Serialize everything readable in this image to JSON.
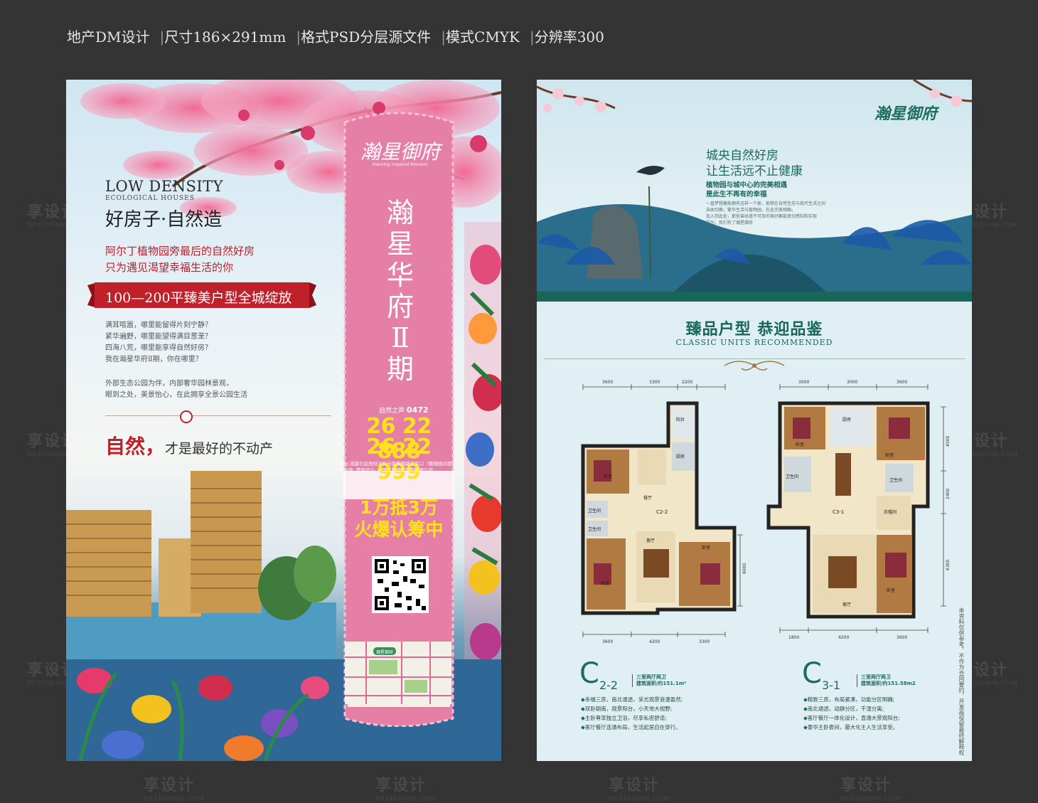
{
  "spec_bar": {
    "items": [
      "地产DM设计",
      "尺寸186×291mm",
      "格式PSD分层源文件",
      "模式CMYK",
      "分辨率300"
    ],
    "separator": "|"
  },
  "watermark": {
    "text": "享设计",
    "sub": "DESIGN006.COM"
  },
  "left_flyer": {
    "headline_en": "LOW DENSITY",
    "headline_en_sub": "ECOLOGICAL HOUSES",
    "slogan": "好房子·自然造",
    "red_lines": [
      "阿尔丁植物园旁最后的自然好房",
      "只为遇见渴望幸福生活的你"
    ],
    "ribbon": "100—200平臻美户型全城绽放",
    "paragraph1": [
      "满耳喧嚣，哪里能留得片刻宁静？",
      "紧华遍野，哪里能望得满目葱茏？",
      "四海八荒，哪里能享得自然好房？",
      "我在瀚星华府Ⅱ期，你在哪里？"
    ],
    "paragraph2": [
      "外部生态公园为伴，内部奢华园林景观，",
      "眼到之处，美景怡心，在此拥享全景公园生活"
    ],
    "nature_big": "自然，",
    "nature_rest": "才是最好的不动产"
  },
  "bookmark": {
    "logo": "瀚星御府",
    "logo_sub": "Hanxing Imperial Mansion",
    "title_chars": [
      "瀚",
      "星",
      "华",
      "府",
      "Ⅱ",
      "期"
    ],
    "hotline_label": "自然之声",
    "area_code": "0472",
    "phones": [
      "26 22 888",
      "26 22 999"
    ],
    "address_lines": [
      "地址:昆都仑区团结大街与民族西路交叉口（植物园对面）",
      "开发商:        策划设计:        中国华夏建设集团有限公司"
    ],
    "offer_lines": [
      "1万抵3万",
      "火爆认筹中"
    ],
    "qr_icon": "qr-code-icon",
    "map_label": "瀚星御府"
  },
  "right_flyer": {
    "brand": "瀚星御府",
    "heading1": "城央自然好房",
    "heading2": "让生活远不止健康",
    "sub1": "植物园与城中心的完美相遇",
    "sub2": "是此生不再有的幸福",
    "small_text": [
      "一直梦想着能拥有这样一个家，能够在自然生态与现代生活之间",
      "自由切换。繁华生活与植物园，在此完美相融，",
      "加入到此处，那些曾经遥不可及的美好都能真切感知和实现",
      "因为，我们有了瀚星御府"
    ],
    "section_title": "臻品户型  恭迎品鉴",
    "section_en": "CLASSIC UNITS RECOMMENDED",
    "units": [
      {
        "code": "C",
        "code_sub": "2-2",
        "plan_label": "C2-2",
        "type": "三室两厅两卫",
        "area": "建筑面积/约151.1m²",
        "features": [
          "幸福三房，南北通透，采光观景浪漫盈然;",
          "双卧朝南，观景阳台，小天地大视野;",
          "主卧尊享独立卫浴，尽享私密舒适;",
          "客厅餐厅连通布局，生活起居自在穿行。"
        ],
        "dims_top": [
          "3600",
          "3300",
          "2200"
        ],
        "dims_bottom": [
          "3600",
          "4200",
          "3300"
        ],
        "dims_left": [
          "3500",
          "1900",
          "2100",
          "3900"
        ],
        "dims_right": [
          "6000"
        ],
        "rooms": [
          "阳台",
          "厨房",
          "卧室",
          "餐厅",
          "卫生间",
          "卫生间",
          "卧室",
          "客厅",
          "卧室"
        ]
      },
      {
        "code": "C",
        "code_sub": "3-1",
        "plan_label": "C3-1",
        "type": "三室两厅两卫",
        "area": "建筑面积/约151.58m2",
        "features": [
          "精致三房，布局紧凑，功能分区明确;",
          "南北通透，动静分区，干湿分离;",
          "客厅餐厅一体化设计，直通大景观阳台;",
          "豪华主卧套间，最大化主人生活享受。"
        ],
        "dims_top": [
          "3000",
          "3000",
          "3600"
        ],
        "dims_bottom": [
          "1800",
          "4200",
          "3600"
        ],
        "dims_right": [
          "4500",
          "2400",
          "6300"
        ],
        "rooms": [
          "厨房",
          "卧室",
          "卧室",
          "卫生间",
          "卫生间",
          "衣帽间",
          "客厅",
          "卧室"
        ]
      }
    ],
    "disclaimer": "本资料仅供参考，不作为合同要约，开发商保留最终解释权"
  },
  "colors": {
    "background": "#343434",
    "pink": "#e57fa6",
    "phone_yellow": "#ffe21a",
    "ribbon_red": "#c0202a",
    "teal": "#1e6a5c"
  }
}
